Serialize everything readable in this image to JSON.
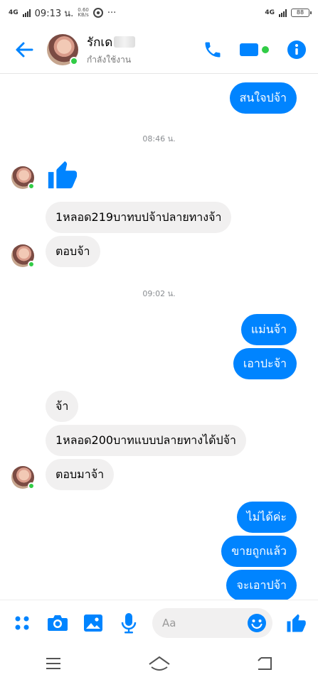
{
  "status_bar": {
    "network": "4G",
    "time": "09:13 น.",
    "speed_value": "0.60",
    "speed_unit": "KB/s",
    "more": "···",
    "right_network": "4G",
    "battery": "88"
  },
  "header": {
    "contact_name": "รักเด",
    "contact_status": "กำลังใช้งาน",
    "icons": [
      "back-arrow-icon",
      "phone-icon",
      "video-call-icon",
      "info-icon"
    ],
    "accent_color": "#0084ff"
  },
  "messages": {
    "m1": "สนใจปจ้า",
    "t1": "08:46 น.",
    "m3": "1หลอด219บาทบปจ้าปลายทางจ้า",
    "m4": "ตอบจ้า",
    "t2": "09:02 น.",
    "m5": "แม่นจ้า",
    "m6": "เอาปะจ้า",
    "m7": "จ้า",
    "m8": "1หลอด200บาทแบบปลายทางได้ปจ้า",
    "m9": "ตอบมาจ้า",
    "m10": "ไม่ได้ค่ะ",
    "m11": "ขายถูกแล้ว",
    "m12": "จะเอาปจ้า"
  },
  "composer": {
    "placeholder": "Aa",
    "icons": [
      "apps-grid-icon",
      "camera-icon",
      "image-icon",
      "microphone-icon",
      "emoji-icon",
      "like-thumb-icon"
    ]
  },
  "nav": {
    "icons": [
      "menu-icon",
      "home-icon",
      "back-icon"
    ]
  }
}
